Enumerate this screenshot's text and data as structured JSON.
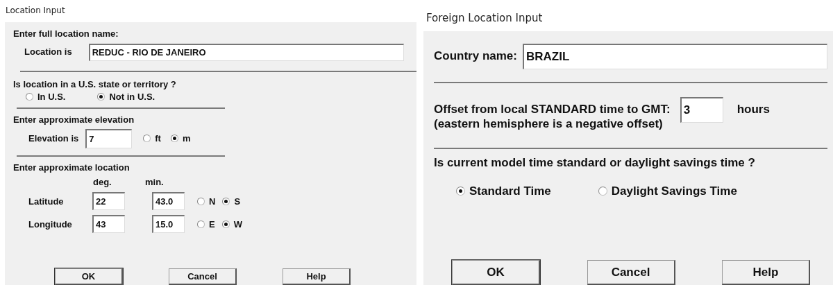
{
  "dialogs": [
    {
      "title": "Location Input",
      "name_section": {
        "heading": "Enter full location name:",
        "label": "Location is",
        "value": "REDUC - RIO DE JANEIRO"
      },
      "us_section": {
        "question": "Is location in a U.S. state or territory ?",
        "options": [
          {
            "label": "In U.S.",
            "selected": false
          },
          {
            "label": "Not in U.S.",
            "selected": true
          }
        ]
      },
      "elevation_section": {
        "heading": "Enter approximate elevation",
        "label": "Elevation is",
        "value": "7",
        "units": [
          {
            "label": "ft",
            "selected": false
          },
          {
            "label": "m",
            "selected": true
          }
        ]
      },
      "location_section": {
        "heading": "Enter approximate location",
        "columns": [
          "deg.",
          "min."
        ],
        "rows": [
          {
            "label": "Latitude",
            "deg": "22",
            "min": "43.0",
            "options": [
              {
                "label": "N",
                "selected": false
              },
              {
                "label": "S",
                "selected": true
              }
            ]
          },
          {
            "label": "Longitude",
            "deg": "43",
            "min": "15.0",
            "options": [
              {
                "label": "E",
                "selected": false
              },
              {
                "label": "W",
                "selected": true
              }
            ]
          }
        ]
      },
      "buttons": [
        {
          "label": "OK",
          "default": true
        },
        {
          "label": "Cancel",
          "default": false
        },
        {
          "label": "Help",
          "default": false
        }
      ]
    },
    {
      "title": "Foreign Location Input",
      "country": {
        "label": "Country name:",
        "value": "BRAZIL"
      },
      "offset": {
        "label": "Offset from local STANDARD time to GMT:",
        "value": "3",
        "unit": "hours",
        "note": "(eastern hemisphere is a negative offset)"
      },
      "time_section": {
        "question": "Is current model time standard or daylight savings time ?",
        "options": [
          {
            "label": "Standard Time",
            "selected": true
          },
          {
            "label": "Daylight Savings Time",
            "selected": false
          }
        ]
      },
      "buttons": [
        {
          "label": "OK",
          "default": true
        },
        {
          "label": "Cancel",
          "default": false
        },
        {
          "label": "Help",
          "default": false
        }
      ]
    }
  ]
}
